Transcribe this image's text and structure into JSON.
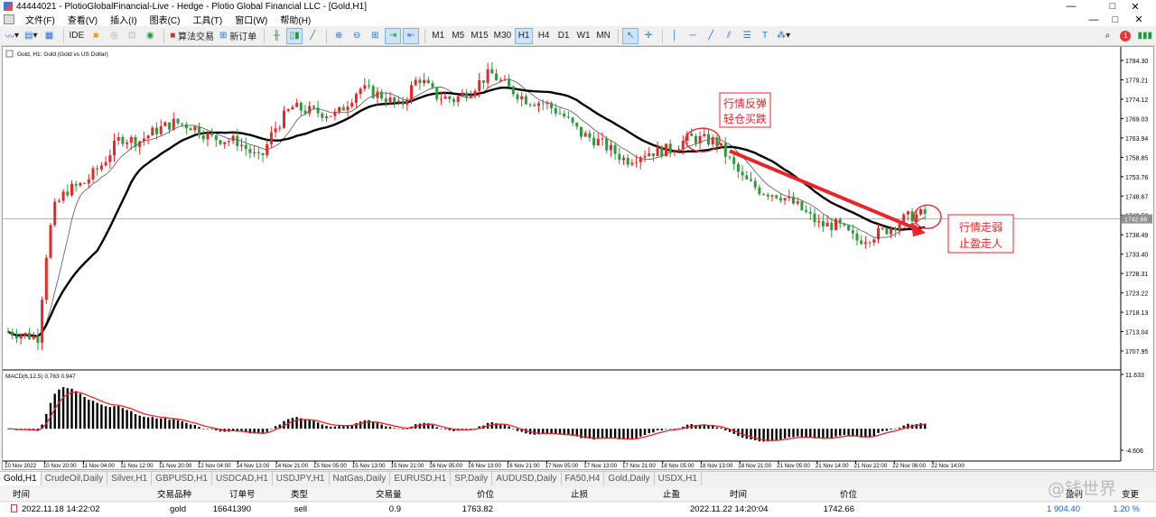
{
  "window": {
    "title": "44444021 - PlotioGlobalFinancial-Live - Hedge - Plotio Global Financial LLC - [Gold,H1]",
    "controls": [
      "—",
      "□",
      "✕"
    ]
  },
  "menu": [
    "文件(F)",
    "查看(V)",
    "插入(I)",
    "图表(C)",
    "工具(T)",
    "窗口(W)",
    "帮助(H)"
  ],
  "toolbar": {
    "ide": "IDE",
    "algo_trading": "算法交易",
    "new_order": "新订单",
    "timeframes": [
      "M1",
      "M5",
      "M15",
      "M30",
      "H1",
      "H4",
      "D1",
      "W1",
      "MN"
    ],
    "active_timeframe": "H1",
    "alert_count": "1"
  },
  "chart": {
    "symbol_label": "Gold, H1:  Gold (Gold vs US Dollar)",
    "price_ticks": [
      "1784.30",
      "1779.21",
      "1774.12",
      "1769.03",
      "1763.94",
      "1758.85",
      "1753.76",
      "1748.67",
      "1743.58",
      "1738.49",
      "1733.40",
      "1728.31",
      "1723.22",
      "1718.13",
      "1713.04",
      "1707.95"
    ],
    "current_price": "1742.66",
    "macd_label": "MACD(6,12,5) 0.763 0.947",
    "macd_ticks": [
      "11.633",
      "-4.606"
    ],
    "time_ticks": [
      "10 Nov 2022",
      "10 Nov 20:00",
      "11 Nov 04:00",
      "11 Nov 12:00",
      "11 Nov 20:00",
      "12 Nov 04:00",
      "14 Nov 13:00",
      "14 Nov 21:00",
      "15 Nov 05:00",
      "15 Nov 13:00",
      "15 Nov 21:00",
      "16 Nov 05:00",
      "16 Nov 13:00",
      "16 Nov 21:00",
      "17 Nov 05:00",
      "17 Nov 13:00",
      "17 Nov 21:00",
      "18 Nov 05:00",
      "18 Nov 13:00",
      "18 Nov 21:00",
      "21 Nov 05:00",
      "21 Nov 14:00",
      "21 Nov 22:00",
      "22 Nov 06:00",
      "22 Nov 14:00"
    ],
    "annotation_1": [
      "行情反弹",
      "轻仓买跌"
    ],
    "annotation_2": [
      "行情走弱",
      "止盈走人"
    ],
    "colors": {
      "bull": "#e8262a",
      "bear": "#2e9a3e",
      "ma_fast": "#555555",
      "ma_slow": "#000000",
      "signal": "#e8262a",
      "annotation": "#e8262a"
    }
  },
  "tabs": [
    "Gold,H1",
    "CrudeOil,Daily",
    "Silver,H1",
    "GBPUSD,H1",
    "USDCAD,H1",
    "USDJPY,H1",
    "NatGas,Daily",
    "EURUSD,H1",
    "SP,Daily",
    "AUDUSD,Daily",
    "FA50,H4",
    "Gold,Daily",
    "USDX,H1"
  ],
  "active_tab": "Gold,H1",
  "terminal": {
    "headers": {
      "time": "时间",
      "symbol": "交易品种",
      "ticket": "订单号",
      "type": "类型",
      "volume": "交易量",
      "price": "价位",
      "sl": "止损",
      "tp": "止盈",
      "close_time": "时间",
      "close_price": "价位",
      "profit": "盈利",
      "change": "变更"
    },
    "row": {
      "time": "2022.11.18 14:22:02",
      "symbol": "gold",
      "ticket": "16641390",
      "type": "sell",
      "volume": "0.9",
      "price": "1763.82",
      "sl": "",
      "tp": "",
      "close_time": "2022.11.22 14:20:04",
      "close_price": "1742.66",
      "profit": "1 904.40",
      "change": "1.20 %"
    }
  },
  "watermark": "@钱世界"
}
